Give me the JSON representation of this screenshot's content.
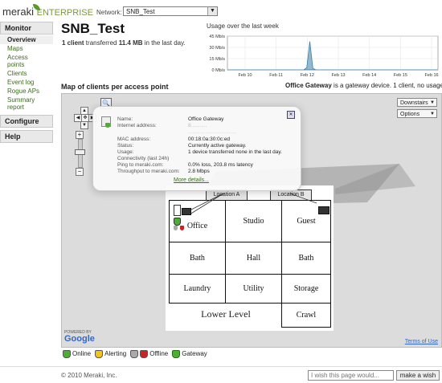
{
  "header": {
    "logo_main": "meraki",
    "logo_sub": "ENTERPRISE",
    "network_label": "Network:",
    "network_value": "SNB_Test"
  },
  "sidebar": {
    "monitor_label": "Monitor",
    "items": [
      {
        "label": "Overview"
      },
      {
        "label": "Maps"
      },
      {
        "label": "Access points"
      },
      {
        "label": "Clients"
      },
      {
        "label": "Event log"
      },
      {
        "label": "Rogue APs"
      },
      {
        "label": "Summary"
      },
      {
        "label": "report"
      }
    ],
    "configure_label": "Configure",
    "help_label": "Help"
  },
  "page": {
    "title": "SNB_Test",
    "sub_pre": "1 client",
    "sub_mid": " transferred ",
    "sub_amount": "11.4 MB",
    "sub_post": " in the last day."
  },
  "chart_data": {
    "type": "area",
    "title": "Usage over the last week",
    "y_ticks": [
      "45 Mb/s",
      "30 Mb/s",
      "15 Mb/s",
      "0 Mb/s"
    ],
    "ylim": [
      0,
      45
    ],
    "x_ticks": [
      "Feb 10",
      "Feb 11",
      "Feb 12",
      "Feb 13",
      "Feb 14",
      "Feb 15",
      "Feb 16"
    ],
    "series": [
      {
        "values": [
          0,
          0,
          0,
          0,
          0,
          0,
          0,
          0,
          0,
          0,
          0,
          0,
          0,
          0,
          0,
          0,
          0,
          0,
          0,
          0,
          0,
          0,
          0,
          0,
          0,
          0,
          3,
          38,
          2,
          0,
          0,
          0,
          0,
          0,
          0,
          0,
          0,
          0,
          0,
          0,
          0,
          0,
          0,
          0,
          0,
          0,
          0,
          0,
          0,
          0,
          0,
          0,
          0,
          0,
          0,
          0,
          0,
          0,
          0,
          0,
          0,
          0,
          0,
          0,
          0,
          0,
          0,
          0,
          0,
          0
        ]
      }
    ],
    "color": "#3a7fa8",
    "grid": true
  },
  "map": {
    "title": "Map of clients per access point",
    "gateway_name": "Office Gateway",
    "gateway_desc": " is a gateway device. 1 client, no usage",
    "view_button": "Downstairs",
    "options_button": "Options",
    "ap_labels": [
      "Location A",
      "Location B"
    ],
    "rooms": [
      "Office",
      "Studio",
      "Guest",
      "Bath",
      "Hall",
      "Bath",
      "Laundry",
      "Utility",
      "Storage",
      "Lower Level",
      "Crawl"
    ],
    "terms": "Terms of Use",
    "powered": "POWERED BY",
    "google": "Google"
  },
  "popup": {
    "rows": [
      {
        "label": "Name:",
        "value": "Office Gateway"
      },
      {
        "label": "Internet address:",
        "value": "8..........."
      },
      {
        "label": "",
        "value": "................................."
      },
      {
        "label": "MAC address:",
        "value": "00:18:0a:30:0c:ed"
      },
      {
        "label": "Status:",
        "value": "Currently active gateway."
      },
      {
        "label": "Usage:",
        "value": "1 device transferred none in the last day."
      },
      {
        "label": "Connectivity (last 24h)",
        "value": ""
      },
      {
        "label": "Ping to meraki.com:",
        "value": "0.0% loss, 203.8 ms latency"
      },
      {
        "label": "Throughput to meraki.com:",
        "value": "2.8 Mbps"
      }
    ],
    "more": "More details..."
  },
  "legend": {
    "online": "Online",
    "alerting": "Alerting",
    "offline": "Offline",
    "gateway": "Gateway"
  },
  "footer": {
    "copyright": "© 2010 Meraki, Inc.",
    "wish_placeholder": "I wish this page would...",
    "wish_button": "make a wish"
  }
}
